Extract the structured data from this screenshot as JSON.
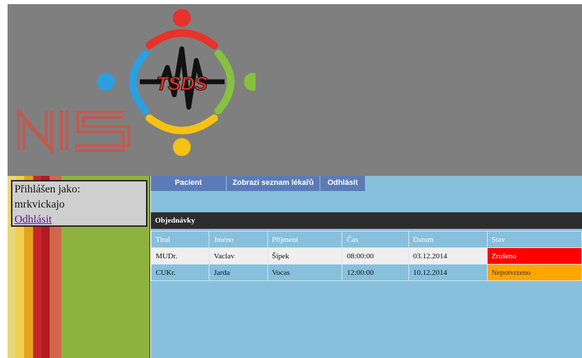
{
  "header": {
    "logo_main_text": "TSDS",
    "logo_secondary_text": "NIS",
    "colors": {
      "red": "#e8322a",
      "blue": "#2d9ee0",
      "green": "#86c23d",
      "yellow": "#f6c213",
      "background": "#7f7f7f"
    }
  },
  "sidebar": {
    "logged_in_label": "Přihlášen jako:",
    "username": "mrkvickajo",
    "logout_link": "Odhlásit"
  },
  "nav": {
    "items": [
      {
        "label": "Pacient"
      },
      {
        "label": "Zobrazi seznam lékařů"
      },
      {
        "label": "Odhlásit"
      }
    ]
  },
  "panel": {
    "title": "Objednávky",
    "columns": [
      "Titul",
      "Jméno",
      "Příjmení",
      "Čas",
      "Datum",
      "Stav"
    ],
    "rows": [
      {
        "titul": "MUDr.",
        "jmeno": "Vaclav",
        "prijmeni": "Šipek",
        "cas": "08:00:00",
        "datum": "03.12.2014",
        "stav": "Zrušeno",
        "stav_color": "#ff0000"
      },
      {
        "titul": "CUKr.",
        "jmeno": "Jarda",
        "prijmeni": "Vocas",
        "cas": "12:00:00",
        "datum": "10.12.2014",
        "stav": "Nepotvrzeno",
        "stav_color": "#ffa500"
      }
    ]
  }
}
